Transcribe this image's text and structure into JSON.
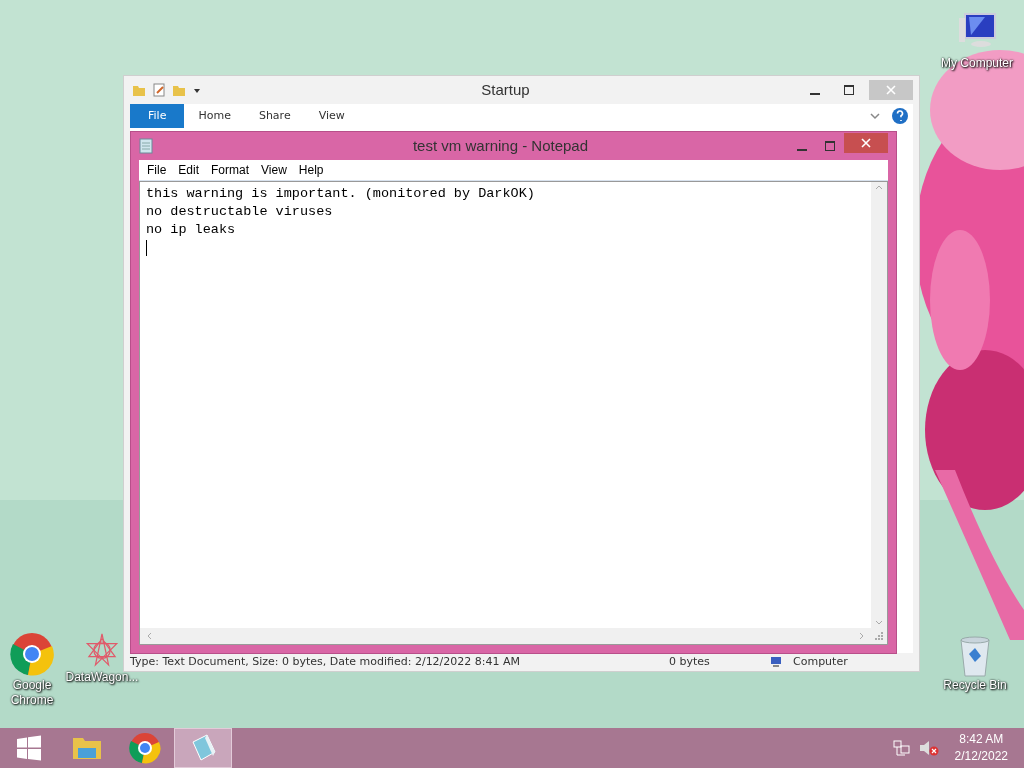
{
  "desktop_icons": [
    {
      "label": "My Computer",
      "kind": "computer"
    },
    {
      "label": "Google Chrome",
      "kind": "chrome"
    },
    {
      "label": "DataWagon...",
      "kind": "app"
    },
    {
      "label": "Recycle Bin",
      "kind": "recycle"
    }
  ],
  "explorer": {
    "title": "Startup",
    "ribbon_tabs": [
      {
        "label": "File",
        "kind": "file"
      },
      {
        "label": "Home",
        "kind": "tab"
      },
      {
        "label": "Share",
        "kind": "tab"
      },
      {
        "label": "View",
        "kind": "tab"
      }
    ],
    "status_bar": {
      "details": "Type: Text Document, Size: 0 bytes, Date modified: 2/12/2022 8:41 AM",
      "size": "0 bytes",
      "location": "Computer"
    }
  },
  "notepad": {
    "title": "test vm warning - Notepad",
    "menu": [
      "File",
      "Edit",
      "Format",
      "View",
      "Help"
    ],
    "lines": [
      "this warning is important. (monitored by DarkOK)",
      "no destructable viruses",
      "no ip leaks"
    ]
  },
  "taskbar": {
    "apps": [
      {
        "kind": "explorer",
        "selected": false
      },
      {
        "kind": "chrome",
        "selected": false
      },
      {
        "kind": "notepad",
        "selected": true
      }
    ],
    "tray": {
      "muted": true,
      "time": "8:42 AM",
      "date": "2/12/2022"
    }
  }
}
